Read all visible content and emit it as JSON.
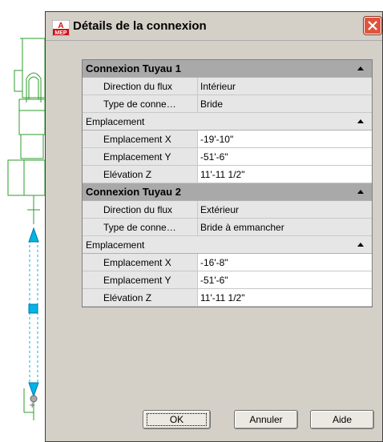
{
  "dialog": {
    "title": "Détails de la connexion",
    "icon_label_top": "A",
    "icon_label_bottom": "MEP"
  },
  "grid": {
    "pipe1": {
      "header": "Connexion Tuyau 1",
      "rows": [
        {
          "name": "Direction du flux",
          "value": "Intérieur"
        },
        {
          "name": "Type de conne…",
          "value": "Bride"
        }
      ],
      "location": {
        "header": "Emplacement",
        "rows": [
          {
            "name": "Emplacement X",
            "value": "-19'-10\""
          },
          {
            "name": "Emplacement Y",
            "value": "-51'-6\""
          },
          {
            "name": "Elévation Z",
            "value": "11'-11 1/2\""
          }
        ]
      }
    },
    "pipe2": {
      "header": "Connexion Tuyau 2",
      "rows": [
        {
          "name": "Direction du flux",
          "value": "Extérieur"
        },
        {
          "name": "Type de conne…",
          "value": "Bride à emmancher"
        }
      ],
      "location": {
        "header": "Emplacement",
        "rows": [
          {
            "name": "Emplacement X",
            "value": "-16'-8\""
          },
          {
            "name": "Emplacement Y",
            "value": "-51'-6\""
          },
          {
            "name": "Elévation Z",
            "value": "11'-11 1/2\""
          }
        ]
      }
    }
  },
  "buttons": {
    "ok": "OK",
    "cancel": "Annuler",
    "help": "Aide"
  },
  "colors": {
    "cad_green": "#2e9e2e",
    "cad_cyan": "#00b4e6",
    "close_red": "#e0543b"
  }
}
